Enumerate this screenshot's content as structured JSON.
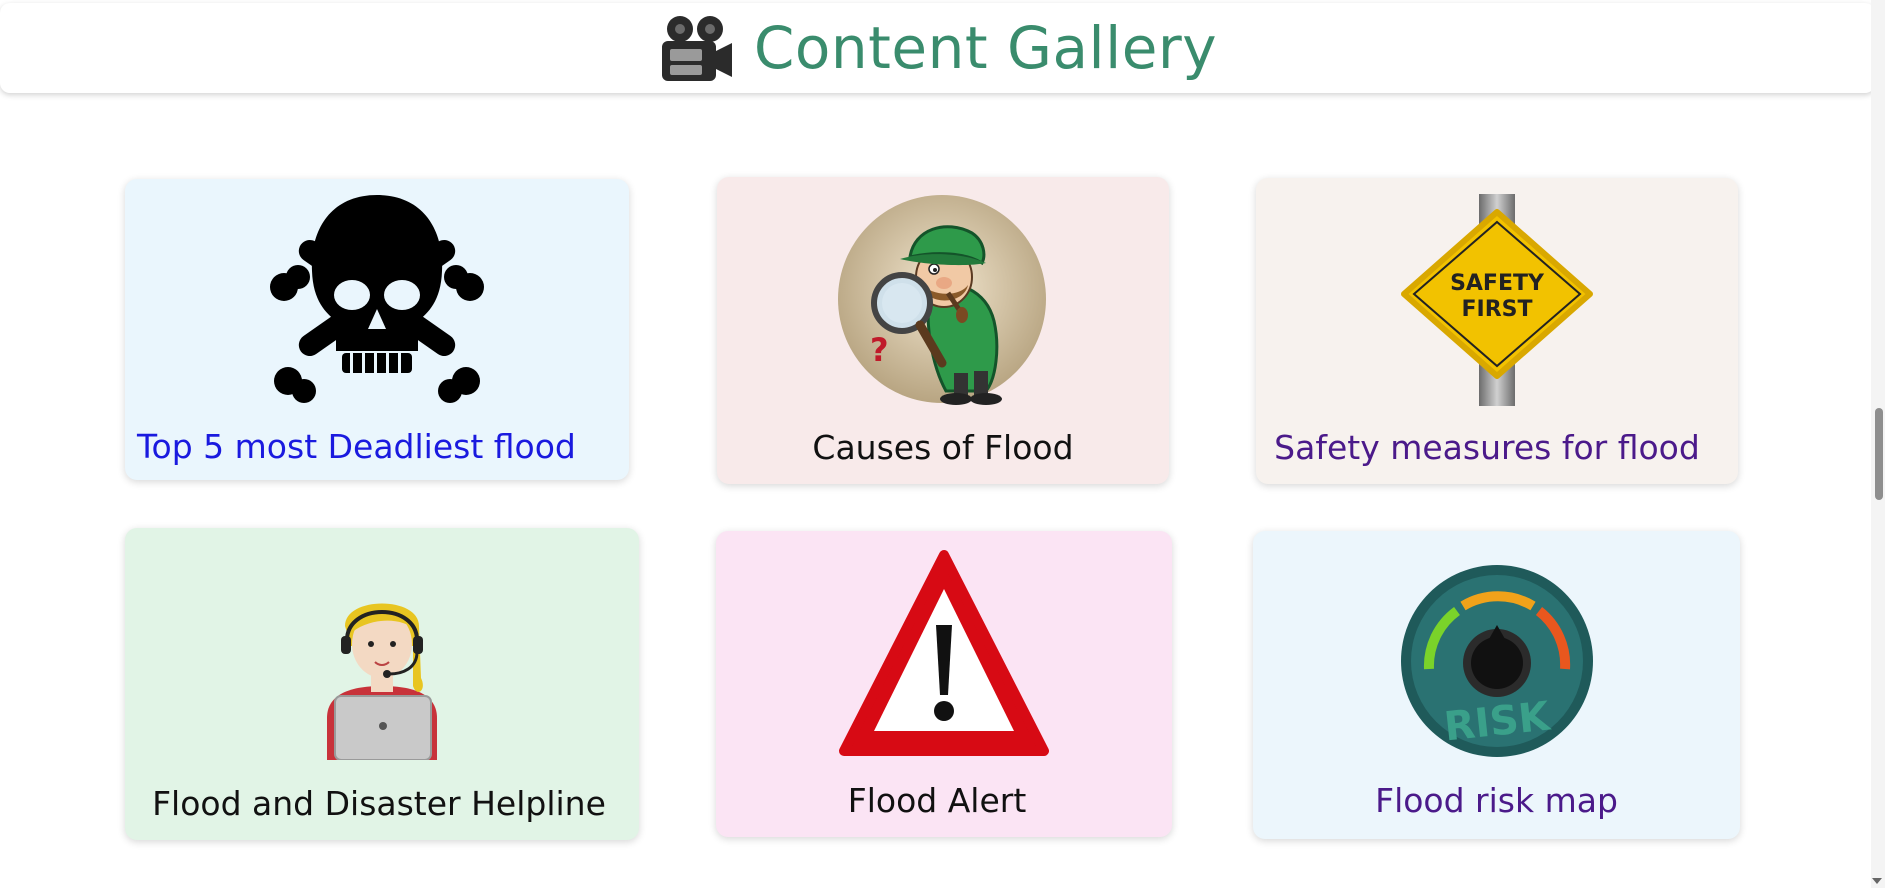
{
  "header": {
    "title": "Content Gallery",
    "icon": "movie-camera-icon",
    "title_color": "#3a8c6d"
  },
  "cards": [
    {
      "label": "Top 5 most Deadliest flood",
      "icon": "skull-crossbones-icon",
      "bg": "#eaf6fd",
      "label_color": "#1a1adf"
    },
    {
      "label": "Causes of Flood",
      "icon": "detective-magnifier-icon",
      "bg": "#f8eaea",
      "label_color": "#111111"
    },
    {
      "label": "Safety measures for flood",
      "icon": "safety-first-sign-icon",
      "bg": "#f7f2ee",
      "label_color": "#4b1a8a"
    },
    {
      "label": "Flood and Disaster Helpline",
      "icon": "helpline-operator-icon",
      "bg": "#e1f4e6",
      "label_color": "#111111"
    },
    {
      "label": "Flood Alert",
      "icon": "warning-triangle-icon",
      "bg": "#fbe4f4",
      "label_color": "#111111"
    },
    {
      "label": "Flood risk map",
      "icon": "risk-gauge-icon",
      "bg": "#ecf6fc",
      "label_color": "#4b1a8a"
    }
  ],
  "sign_text": {
    "line1": "SAFETY",
    "line2": "FIRST"
  },
  "gauge_text": "RISK"
}
